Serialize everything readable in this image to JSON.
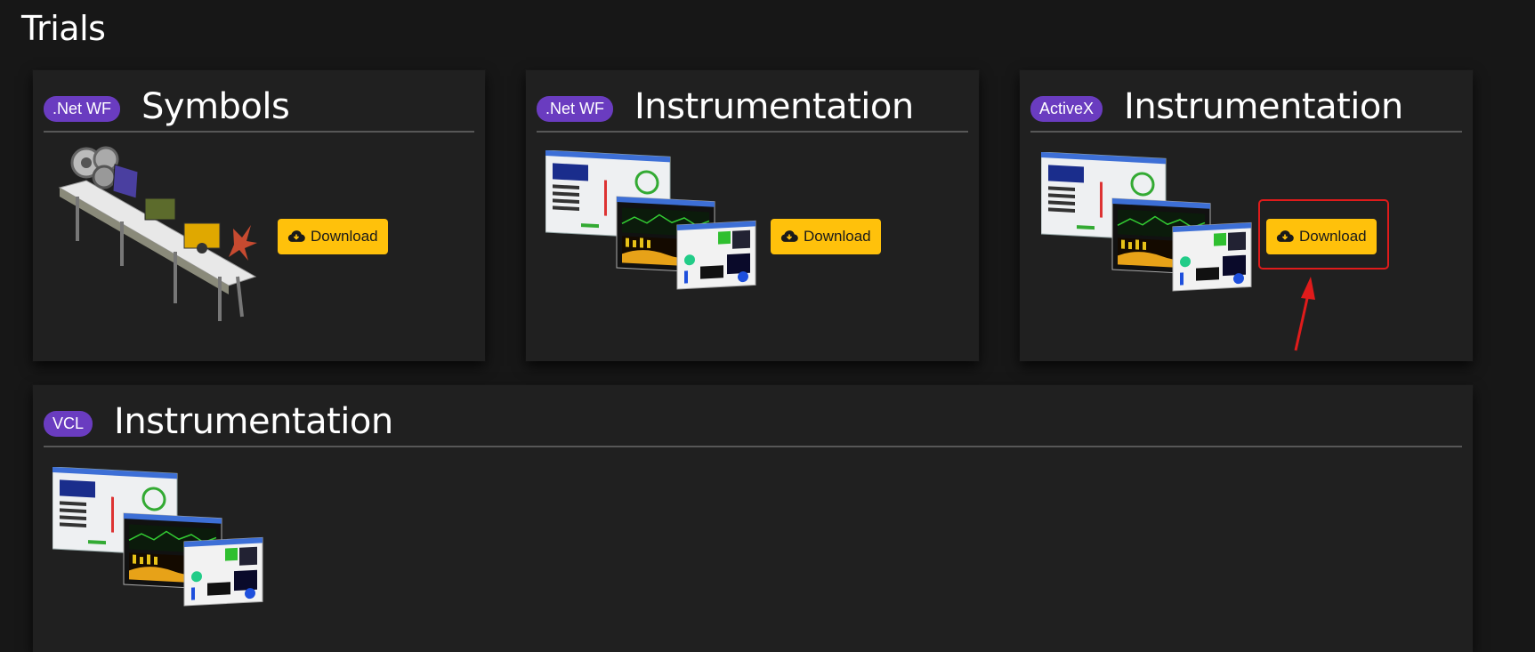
{
  "page": {
    "title": "Trials"
  },
  "cards": [
    {
      "badge": ".Net WF",
      "title": "Symbols",
      "button": "Download",
      "image": "conveyor-symbols-illustration"
    },
    {
      "badge": ".Net WF",
      "title": "Instrumentation",
      "button": "Download",
      "image": "instrumentation-screenshots-stack"
    },
    {
      "badge": "ActiveX",
      "title": "Instrumentation",
      "button": "Download",
      "image": "instrumentation-screenshots-stack"
    },
    {
      "badge": "VCL",
      "title": "Instrumentation",
      "image": "instrumentation-screenshots-stack"
    }
  ],
  "colors": {
    "background": "#171717",
    "card": "#202020",
    "badge": "#6a3cc0",
    "button": "#ffc10b",
    "annotation": "#e01b1b"
  },
  "icons": {
    "download": "cloud-download-icon",
    "annotation_arrow": "red-arrow-annotation"
  }
}
